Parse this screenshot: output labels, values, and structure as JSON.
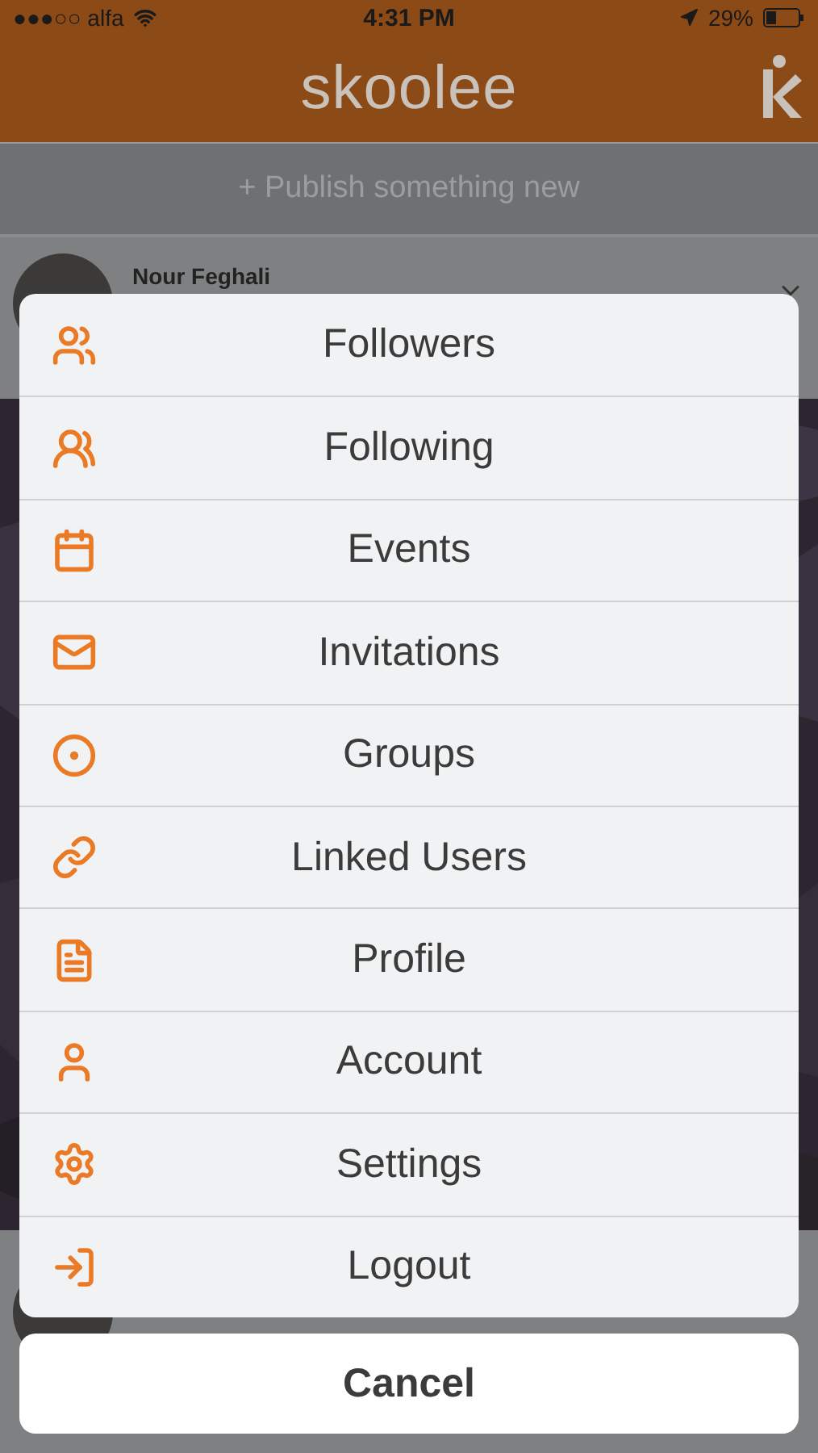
{
  "status_bar": {
    "carrier": "●●●○○ alfa",
    "time": "4:31 PM",
    "battery": "29%"
  },
  "header": {
    "logo": "skoolee"
  },
  "publish": {
    "label": "+ Publish something new"
  },
  "post": {
    "author": "Nour Feghali"
  },
  "action_sheet": {
    "items": [
      {
        "label": "Followers"
      },
      {
        "label": "Following"
      },
      {
        "label": "Events"
      },
      {
        "label": "Invitations"
      },
      {
        "label": "Groups"
      },
      {
        "label": "Linked Users"
      },
      {
        "label": "Profile"
      },
      {
        "label": "Account"
      },
      {
        "label": "Settings"
      },
      {
        "label": "Logout"
      }
    ],
    "cancel": "Cancel"
  }
}
